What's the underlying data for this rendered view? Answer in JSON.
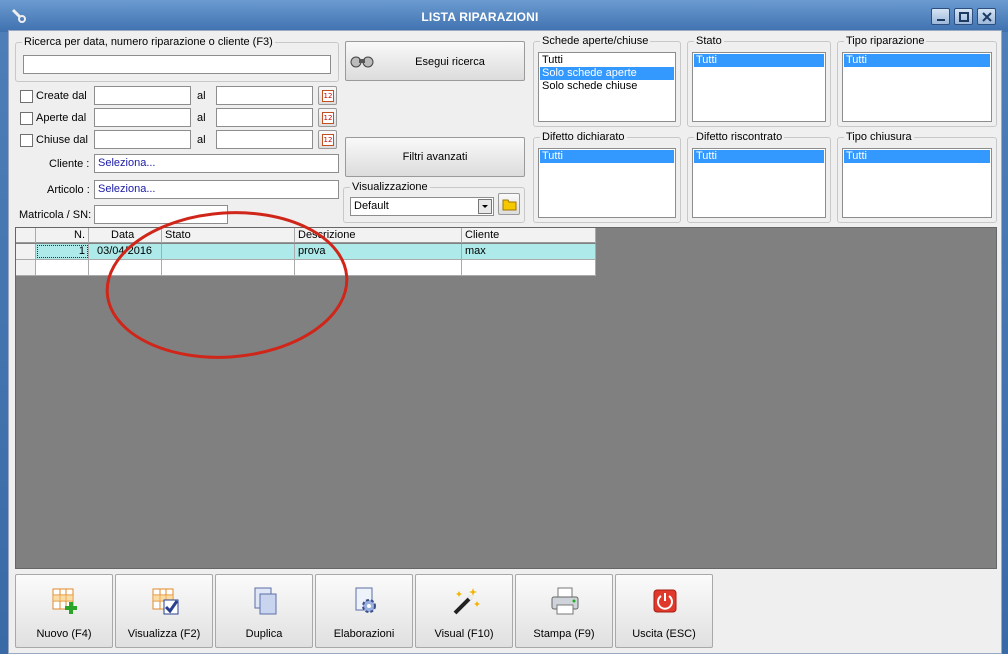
{
  "window": {
    "title": "LISTA RIPARAZIONI"
  },
  "search": {
    "caption": "Ricerca per data, numero riparazione o cliente (F3)",
    "value": "",
    "button_label": "Esegui ricerca"
  },
  "date_filters": [
    {
      "label": "Create dal",
      "to_label": "al",
      "from": "",
      "to": ""
    },
    {
      "label": "Aperte dal",
      "to_label": "al",
      "from": "",
      "to": ""
    },
    {
      "label": "Chiuse dal",
      "to_label": "al",
      "from": "",
      "to": ""
    }
  ],
  "calendar_glyph": "12",
  "cliente": {
    "label": "Cliente :",
    "value": "Seleziona..."
  },
  "articolo": {
    "label": "Articolo :",
    "value": "Seleziona..."
  },
  "matricola": {
    "label": "Matricola / SN:",
    "value": ""
  },
  "advanced_filters": {
    "label": "Filtri avanzati"
  },
  "visualizzazione": {
    "caption": "Visualizzazione",
    "selected": "Default"
  },
  "lists": {
    "schede": {
      "caption": "Schede aperte/chiuse",
      "items": [
        "Tutti",
        "Solo schede aperte",
        "Solo schede chiuse"
      ],
      "selected_index": 1
    },
    "stato": {
      "caption": "Stato",
      "items": [
        "Tutti"
      ],
      "selected_index": 0
    },
    "tipo_riparazione": {
      "caption": "Tipo riparazione",
      "items": [
        "Tutti"
      ],
      "selected_index": 0
    },
    "difetto_dichiarato": {
      "caption": "Difetto dichiarato",
      "items": [
        "Tutti"
      ],
      "selected_index": 0
    },
    "difetto_riscontrato": {
      "caption": "Difetto riscontrato",
      "items": [
        "Tutti"
      ],
      "selected_index": 0
    },
    "tipo_chiusura": {
      "caption": "Tipo chiusura",
      "items": [
        "Tutti"
      ],
      "selected_index": 0
    }
  },
  "table": {
    "columns": [
      "N.",
      "Data",
      "Stato",
      "Descrizione",
      "Cliente"
    ],
    "rows": [
      {
        "n": "1",
        "data": "03/04/2016",
        "stato": "",
        "descrizione": "prova",
        "cliente": "max"
      }
    ]
  },
  "colors": {
    "row_highlight": "#aeeaea",
    "annotation": "#d0261a",
    "grid_bg": "#808080"
  },
  "toolbar": [
    {
      "label": "Nuovo (F4)",
      "icon": "new-record-icon"
    },
    {
      "label": "Visualizza (F2)",
      "icon": "view-record-icon"
    },
    {
      "label": "Duplica",
      "icon": "duplicate-icon"
    },
    {
      "label": "Elaborazioni",
      "icon": "processing-icon"
    },
    {
      "label": "Visual (F10)",
      "icon": "magic-wand-icon"
    },
    {
      "label": "Stampa (F9)",
      "icon": "printer-icon"
    },
    {
      "label": "Uscita (ESC)",
      "icon": "exit-icon"
    }
  ]
}
